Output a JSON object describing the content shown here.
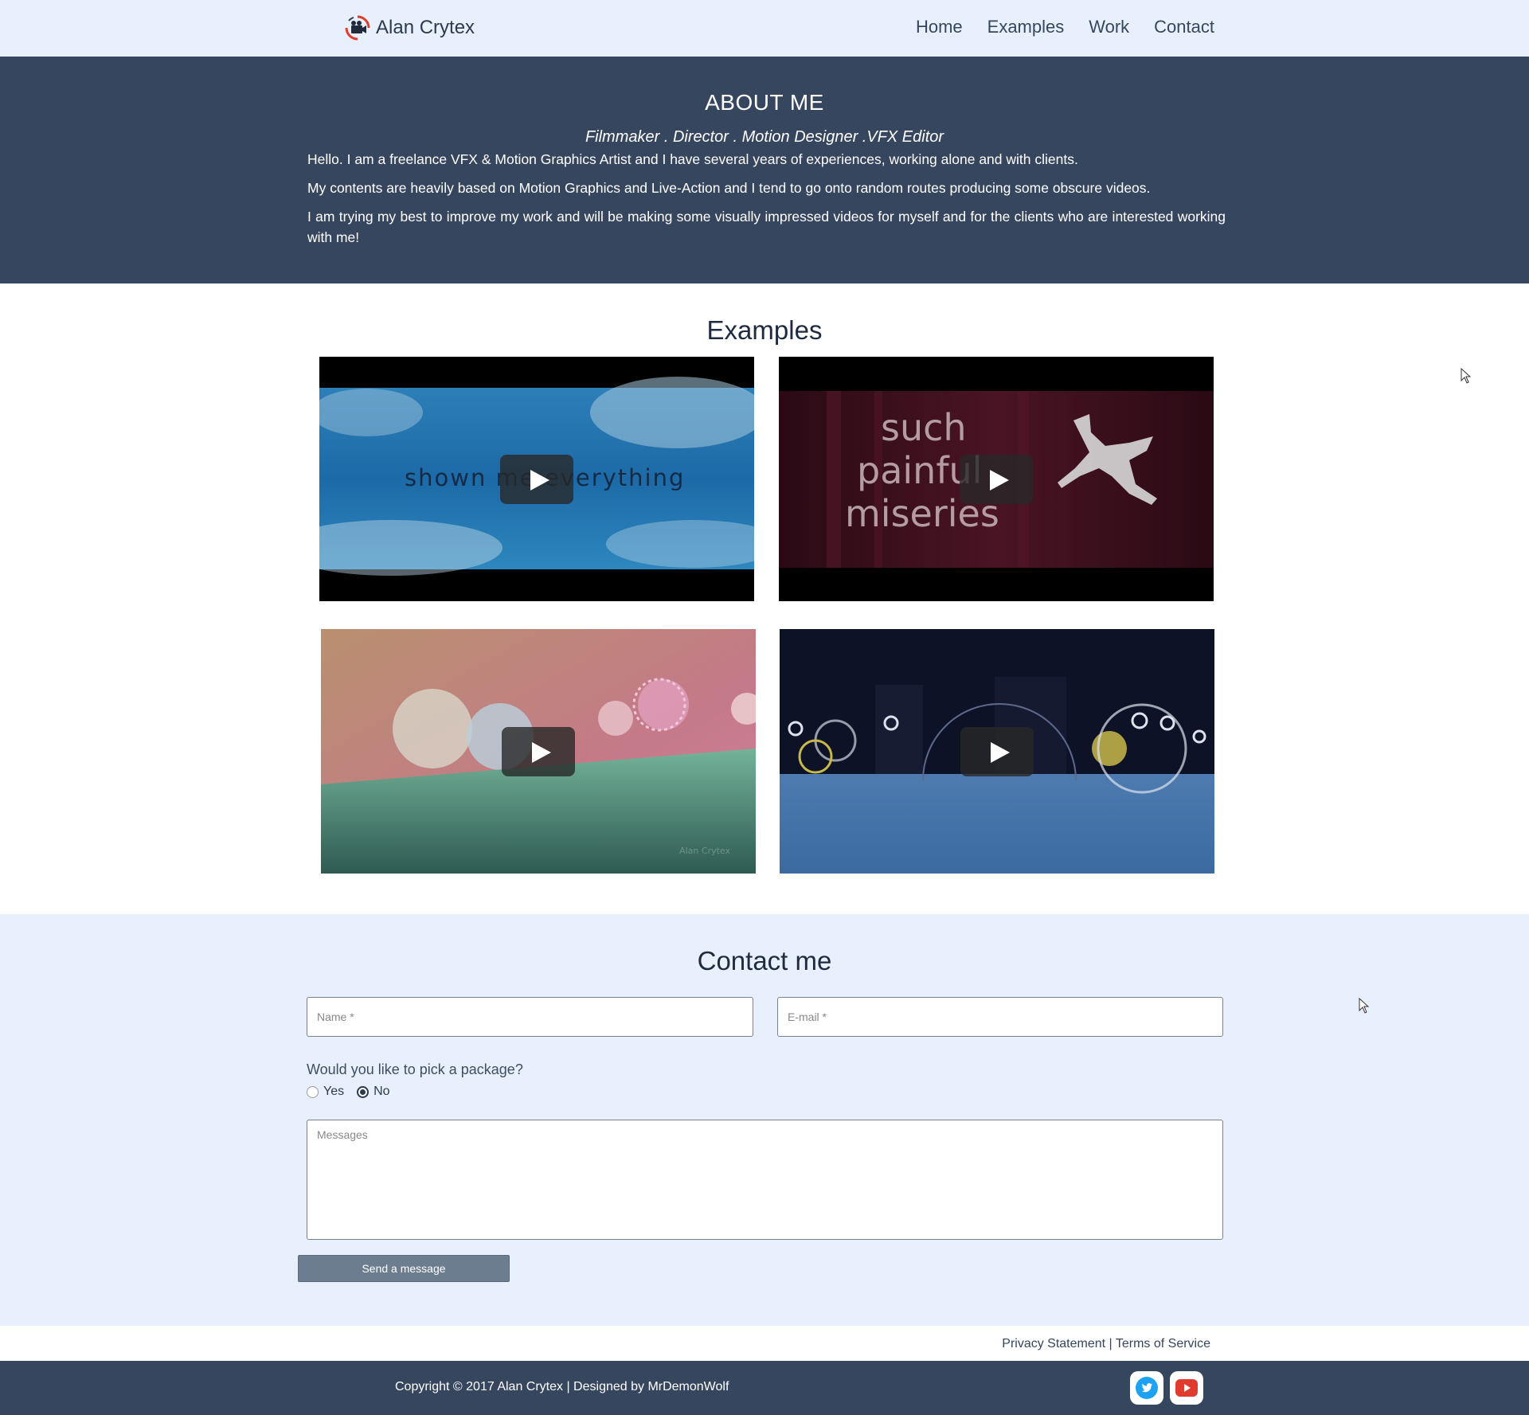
{
  "nav": {
    "brand": "Alan Crytex",
    "links": [
      "Home",
      "Examples",
      "Work",
      "Contact"
    ]
  },
  "about": {
    "title": "ABOUT ME",
    "roles": "Filmmaker . Director . Motion Designer .VFX Editor",
    "paragraphs": [
      "Hello. I am a freelance VFX & Motion Graphics Artist and I have several years of experiences, working alone and with clients.",
      "My contents are heavily based on Motion Graphics and Live-Action and I tend to go onto random routes producing some obscure videos.",
      "I am trying my best to improve my work and will be making some visually impressed videos for myself and for the clients who are interested working with me!"
    ]
  },
  "examples": {
    "title": "Examples",
    "videos": [
      {
        "thumb_text": "shown me everything"
      },
      {
        "thumb_text_lines": [
          "such",
          "painful",
          "miseries"
        ]
      },
      {
        "watermark": "Alan Crytex"
      },
      {}
    ]
  },
  "contact": {
    "title": "Contact me",
    "name_placeholder": "Name *",
    "email_placeholder": "E-mail *",
    "question": "Would you like to pick a package?",
    "options": [
      "Yes",
      "No"
    ],
    "selected": "No",
    "message_placeholder": "Messages",
    "send_label": "Send a message"
  },
  "legal": {
    "privacy": "Privacy Statement",
    "separator": "|",
    "terms": "Terms of Service"
  },
  "footer": {
    "copyright": "Copyright © 2017 Alan Crytex | Designed by MrDemonWolf",
    "social_icons": [
      "twitter-icon",
      "youtube-icon"
    ]
  },
  "colors": {
    "nav_bg": "#e8f0fd",
    "dark_band": "#37465f",
    "twitter": "#1da1f2",
    "youtube": "#e03c2e",
    "button": "#6d7d90"
  }
}
